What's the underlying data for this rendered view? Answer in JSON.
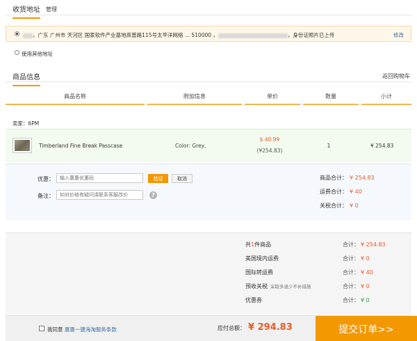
{
  "address": {
    "title": "收货地址",
    "manage": "管理",
    "selected_text": "，广东 广州市 天河区 国家软件产业基地高普路115号太平洋网络 ... 510000 ，",
    "selected_suffix": "，身份证照片已上传",
    "edit": "修改",
    "other": "使用其他地址"
  },
  "goods": {
    "title": "商品信息",
    "back_cart": "返回购物车",
    "columns": [
      "商品名称",
      "附加信息",
      "单价",
      "数量",
      "小计"
    ],
    "seller": "卖家：6PM",
    "item": {
      "name": "Timberland Fine Break Passcase",
      "extra": "Color: Grey,",
      "price": "$ 40.99",
      "price_cny": "(¥254.83)",
      "qty": "1",
      "subtotal": "¥ 254.83"
    }
  },
  "coupon": {
    "label": "优惠：",
    "placeholder": "输入惠惠优惠码",
    "verify": "验证",
    "cancel": "取消",
    "remark_label": "备注：",
    "remark_placeholder": "如对价格有疑问请联系客服改价",
    "help": "?"
  },
  "summary": {
    "goods_total_label": "商品合计：",
    "goods_total": "¥ 254.83",
    "shipping_label": "运费合计：",
    "shipping": "¥ 40",
    "tax_label": "关税合计：",
    "tax": "¥ 0"
  },
  "totals": {
    "count_prefix": "共",
    "count": "1",
    "count_suffix": "件商品",
    "us_ship": "美国境内运费",
    "intl_ship": "国际转运费",
    "prepaid_tax": "预收关税",
    "prepaid_note": "采取多退少不补措施",
    "coupon": "优惠券",
    "sum_label": "合计：",
    "values": [
      "¥ 254.83",
      "¥ 0",
      "¥ 40",
      "¥ 0",
      "¥ 0"
    ]
  },
  "footer": {
    "agree_prefix": "我同意",
    "agree_link": "惠惠一键海淘服务条款",
    "pay_label": "应付总额：",
    "pay_total": "¥ 294.83",
    "submit": "提交订单>>"
  },
  "colors": {
    "accent": "#f39800",
    "price": "#e85a25",
    "link": "#3a6ea5"
  }
}
